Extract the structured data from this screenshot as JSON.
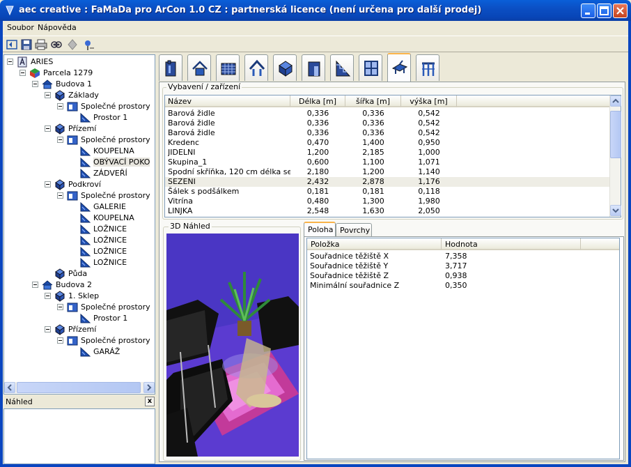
{
  "window": {
    "title": "aec creative : FaMaDa pro ArCon 1.0 CZ : partnerská licence (není určena pro další prodej)"
  },
  "menu": {
    "items": [
      "Soubor",
      "Nápověda"
    ]
  },
  "toolbar": {
    "buttons": [
      "refresh-icon",
      "save-icon",
      "print-icon",
      "view-icon",
      "diamond-icon",
      "pin-icon"
    ]
  },
  "tree": {
    "nodes": [
      {
        "label": "ARIES",
        "level": 0,
        "icon": "project-icon",
        "expandable": true
      },
      {
        "label": "Parcela 1279",
        "level": 1,
        "icon": "parcel-icon",
        "expandable": true
      },
      {
        "label": "Budova 1",
        "level": 2,
        "icon": "building-icon",
        "expandable": true
      },
      {
        "label": "Základy",
        "level": 3,
        "icon": "floor-icon",
        "expandable": true
      },
      {
        "label": "Společné prostory",
        "level": 4,
        "icon": "space-group-icon",
        "expandable": true
      },
      {
        "label": "Prostor 1",
        "level": 5,
        "icon": "room-icon",
        "expandable": false
      },
      {
        "label": "Přízemí",
        "level": 3,
        "icon": "floor-icon",
        "expandable": true
      },
      {
        "label": "Společné prostory",
        "level": 4,
        "icon": "space-group-icon",
        "expandable": true
      },
      {
        "label": "KOUPELNA",
        "level": 5,
        "icon": "room-icon",
        "expandable": false
      },
      {
        "label": "OBÝVACÍ POKO",
        "level": 5,
        "icon": "room-icon",
        "expandable": false,
        "selected": true
      },
      {
        "label": "ZÁDVEŘÍ",
        "level": 5,
        "icon": "room-icon",
        "expandable": false
      },
      {
        "label": "Podkroví",
        "level": 3,
        "icon": "floor-icon",
        "expandable": true
      },
      {
        "label": "Společné prostory",
        "level": 4,
        "icon": "space-group-icon",
        "expandable": true
      },
      {
        "label": "GALERIE",
        "level": 5,
        "icon": "room-icon",
        "expandable": false
      },
      {
        "label": "KOUPELNA",
        "level": 5,
        "icon": "room-icon",
        "expandable": false
      },
      {
        "label": "LOŽNICE",
        "level": 5,
        "icon": "room-icon",
        "expandable": false
      },
      {
        "label": "LOŽNICE",
        "level": 5,
        "icon": "room-icon",
        "expandable": false
      },
      {
        "label": "LOŽNICE",
        "level": 5,
        "icon": "room-icon",
        "expandable": false
      },
      {
        "label": "LOŽNICE",
        "level": 5,
        "icon": "room-icon",
        "expandable": false
      },
      {
        "label": "Půda",
        "level": 3,
        "icon": "floor-icon",
        "expandable": false
      },
      {
        "label": "Budova 2",
        "level": 2,
        "icon": "building-icon",
        "expandable": true
      },
      {
        "label": "1. Sklep",
        "level": 3,
        "icon": "floor-icon",
        "expandable": true
      },
      {
        "label": "Společné prostory",
        "level": 4,
        "icon": "space-group-icon",
        "expandable": true
      },
      {
        "label": "Prostor 1",
        "level": 5,
        "icon": "room-icon",
        "expandable": false
      },
      {
        "label": "Přízemí",
        "level": 3,
        "icon": "floor-icon",
        "expandable": true
      },
      {
        "label": "Společné prostory",
        "level": 4,
        "icon": "space-group-icon",
        "expandable": true
      },
      {
        "label": "GARÁŽ",
        "level": 5,
        "icon": "room-icon",
        "expandable": false
      }
    ]
  },
  "preview_panel": {
    "title": "Náhled",
    "close_label": "x"
  },
  "category_tabs": [
    {
      "icon": "info-icon"
    },
    {
      "icon": "house-icon"
    },
    {
      "icon": "grid-icon"
    },
    {
      "icon": "roof-icon"
    },
    {
      "icon": "cube-icon"
    },
    {
      "icon": "door-icon"
    },
    {
      "icon": "stairs-icon"
    },
    {
      "icon": "window-icon"
    },
    {
      "icon": "furniture-icon",
      "active": true
    },
    {
      "icon": "railing-icon"
    }
  ],
  "equipment": {
    "group_title": "Vybavení / zařízení",
    "columns": [
      "Název",
      "Délka [m]",
      "šířka [m]",
      "výška [m]"
    ],
    "rows": [
      [
        "Barová židle",
        "0,336",
        "0,336",
        "0,542"
      ],
      [
        "Barová židle",
        "0,336",
        "0,336",
        "0,542"
      ],
      [
        "Barová židle",
        "0,336",
        "0,336",
        "0,542"
      ],
      [
        "Kredenc",
        "0,470",
        "1,400",
        "0,950"
      ],
      [
        "JIDELNI",
        "1,200",
        "2,185",
        "1,000"
      ],
      [
        "Skupina_1",
        "0,600",
        "1,100",
        "1,071"
      ],
      [
        "Spodní skříňka, 120 cm délka se ...",
        "2,180",
        "1,200",
        "1,140"
      ],
      [
        "SEZENI",
        "2,432",
        "2,878",
        "1,176"
      ],
      [
        "Šálek s podšálkem",
        "0,181",
        "0,181",
        "0,118"
      ],
      [
        "Vitrína",
        "0,480",
        "1,300",
        "1,980"
      ],
      [
        "LINJKA",
        "2,548",
        "1,630",
        "2,050"
      ]
    ],
    "selected_row": 7
  },
  "view3d": {
    "title": "3D Náhled"
  },
  "properties": {
    "tabs": [
      "Poloha",
      "Povrchy"
    ],
    "active_tab": 0,
    "columns": [
      "Položka",
      "Hodnota"
    ],
    "rows": [
      [
        "Souřadnice těžiště X",
        "7,358"
      ],
      [
        "Souřadnice těžiště Y",
        "3,717"
      ],
      [
        "Souřadnice těžiště Z",
        "0,938"
      ],
      [
        "Minimální souřadnice Z",
        "0,350"
      ]
    ]
  }
}
